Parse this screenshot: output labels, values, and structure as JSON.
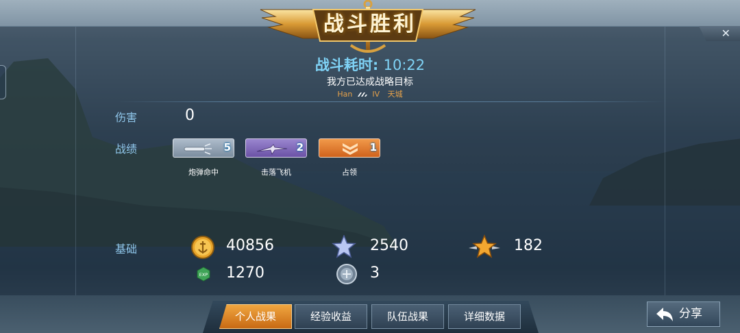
{
  "banner": {
    "title": "战斗胜利"
  },
  "close": {
    "label": "✕"
  },
  "battle": {
    "duration_label": "战斗耗时:",
    "duration_value": "10:22",
    "objective": "我方已达成战略目标",
    "ship_nation": "Han",
    "ship_tier": "IV",
    "ship_name": "天城"
  },
  "stats": {
    "damage_label": "伤害",
    "damage_value": "0",
    "achievements_label": "战绩",
    "achievements": [
      {
        "name": "炮弹命中",
        "count": "5",
        "color": "#8a9fb2",
        "icon": "torpedo-icon"
      },
      {
        "name": "击落飞机",
        "count": "2",
        "color": "#7e64b8",
        "icon": "aircraft-icon"
      },
      {
        "name": "占领",
        "count": "1",
        "color": "#e3742a",
        "icon": "chevron-icon"
      }
    ]
  },
  "base": {
    "label": "基础",
    "credits": "40856",
    "silver_star": "2540",
    "gold_star": "182",
    "exp": "1270",
    "medal": "3"
  },
  "tabs": [
    {
      "label": "个人战果",
      "active": true
    },
    {
      "label": "经验收益",
      "active": false
    },
    {
      "label": "队伍战果",
      "active": false
    },
    {
      "label": "详细数据",
      "active": false
    }
  ],
  "share": {
    "label": "分享"
  },
  "colors": {
    "accent_blue": "#7fd3f6",
    "gold": "#e7a24a",
    "tab_active": "#e7912e"
  }
}
